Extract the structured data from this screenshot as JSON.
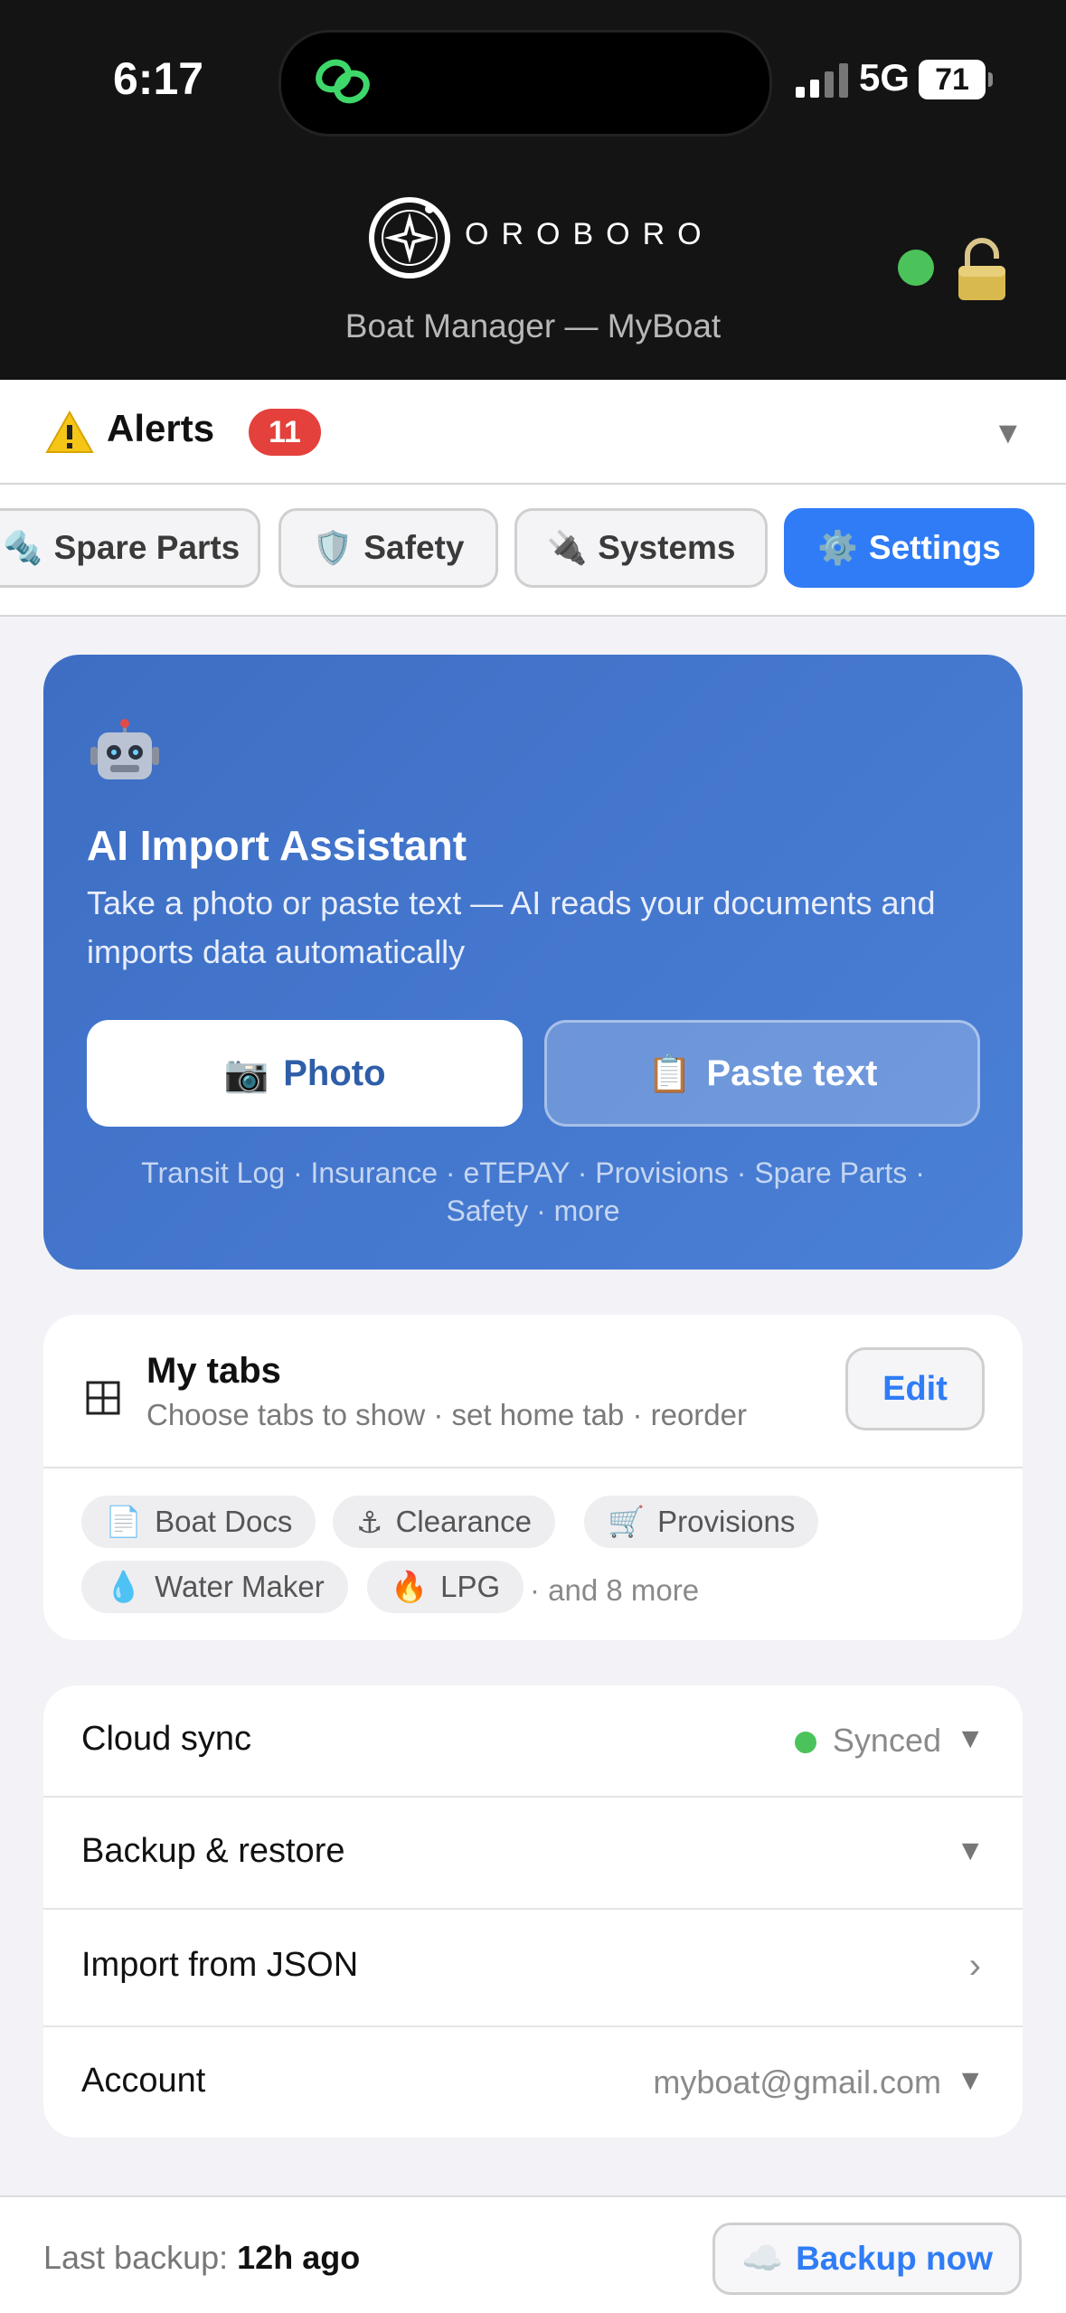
{
  "status_bar": {
    "time": "6:17",
    "network": "5G",
    "battery": "71"
  },
  "header": {
    "brand": "OROBORO",
    "subtitle": "Boat Manager — MyBoat",
    "online_color": "#4cc35a"
  },
  "alerts": {
    "label": "Alerts",
    "count": "11",
    "toggle": "▼",
    "icon": "warning-icon"
  },
  "tabs": [
    {
      "label": "Spare Parts",
      "icon": "🔩",
      "active": false
    },
    {
      "label": "Safety",
      "icon": "🛡️",
      "active": false
    },
    {
      "label": "Systems",
      "icon": "🔌",
      "active": false
    },
    {
      "label": "Settings",
      "icon": "⚙️",
      "active": true
    }
  ],
  "ai_import": {
    "icon": "robot-icon",
    "title": "AI Import Assistant",
    "description": "Take a photo or paste text — AI reads your documents and imports data automatically",
    "photo_button": {
      "icon": "📷",
      "label": "Photo"
    },
    "paste_button": {
      "icon": "📋",
      "label": "Paste text"
    },
    "types": "Transit Log · Insurance · eTEPAY · Provisions · Spare Parts · Safety · more"
  },
  "my_tabs": {
    "title": "My tabs",
    "subtitle": "Choose tabs to show · set home tab · reorder",
    "edit_label": "Edit",
    "chips": [
      {
        "icon": "📄",
        "label": "Boat Docs"
      },
      {
        "icon": "⚓",
        "label": "Clearance"
      },
      {
        "icon": "🛒",
        "label": "Provisions"
      },
      {
        "icon": "💧",
        "label": "Water Maker"
      },
      {
        "icon": "🔥",
        "label": "LPG"
      }
    ],
    "more": "· and 8 more"
  },
  "settings": [
    {
      "label": "Cloud sync",
      "value": "Synced",
      "status_color": "#4cc35a",
      "chevron": "▼"
    },
    {
      "label": "Backup & restore",
      "value": "",
      "chevron": "▼"
    },
    {
      "label": "Import from JSON",
      "value": "",
      "chevron": "›"
    },
    {
      "label": "Account",
      "value": "myboat@gmail.com",
      "chevron": "▼"
    }
  ],
  "bottom_bar": {
    "last_backup_label": "Last backup:",
    "last_backup_value": "12h ago",
    "backup_button": {
      "icon": "☁️",
      "label": "Backup now"
    }
  },
  "colors": {
    "accent": "#2f7cf6",
    "alert_badge": "#e4413c",
    "card_gradient_start": "#3d6ec4",
    "card_gradient_end": "#4a80d6"
  }
}
